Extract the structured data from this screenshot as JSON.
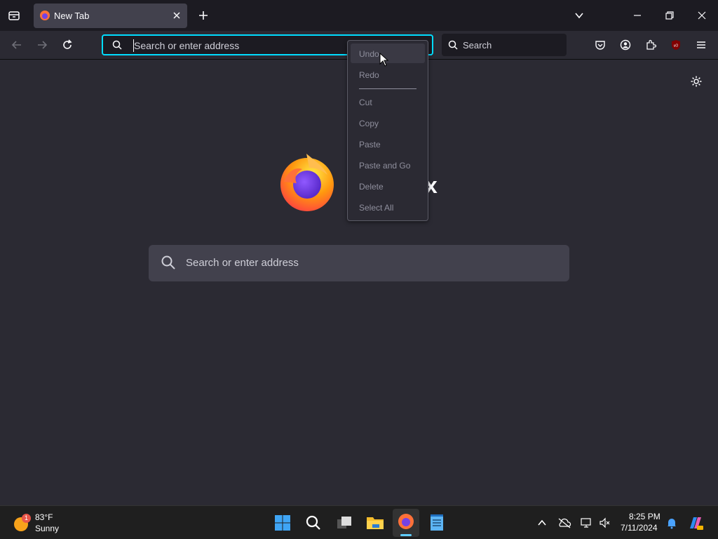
{
  "tab": {
    "title": "New Tab",
    "favicon": "firefox-icon"
  },
  "toolbar": {
    "url_placeholder": "Search or enter address",
    "search_placeholder": "Search"
  },
  "content": {
    "brand_partial": "x",
    "search_placeholder": "Search or enter address"
  },
  "context_menu": {
    "items": [
      {
        "label": "Undo"
      },
      {
        "label": "Redo"
      },
      {
        "label": "Cut"
      },
      {
        "label": "Copy"
      },
      {
        "label": "Paste"
      },
      {
        "label": "Paste and Go"
      },
      {
        "label": "Delete"
      },
      {
        "label": "Select All"
      }
    ]
  },
  "taskbar": {
    "weather": {
      "temp": "83°F",
      "condition": "Sunny",
      "badge": "1"
    },
    "clock": {
      "time": "8:25 PM",
      "date": "7/11/2024"
    }
  },
  "colors": {
    "accent": "#00ddff",
    "background": "#2b2a33",
    "titlebar": "#1c1b22"
  }
}
